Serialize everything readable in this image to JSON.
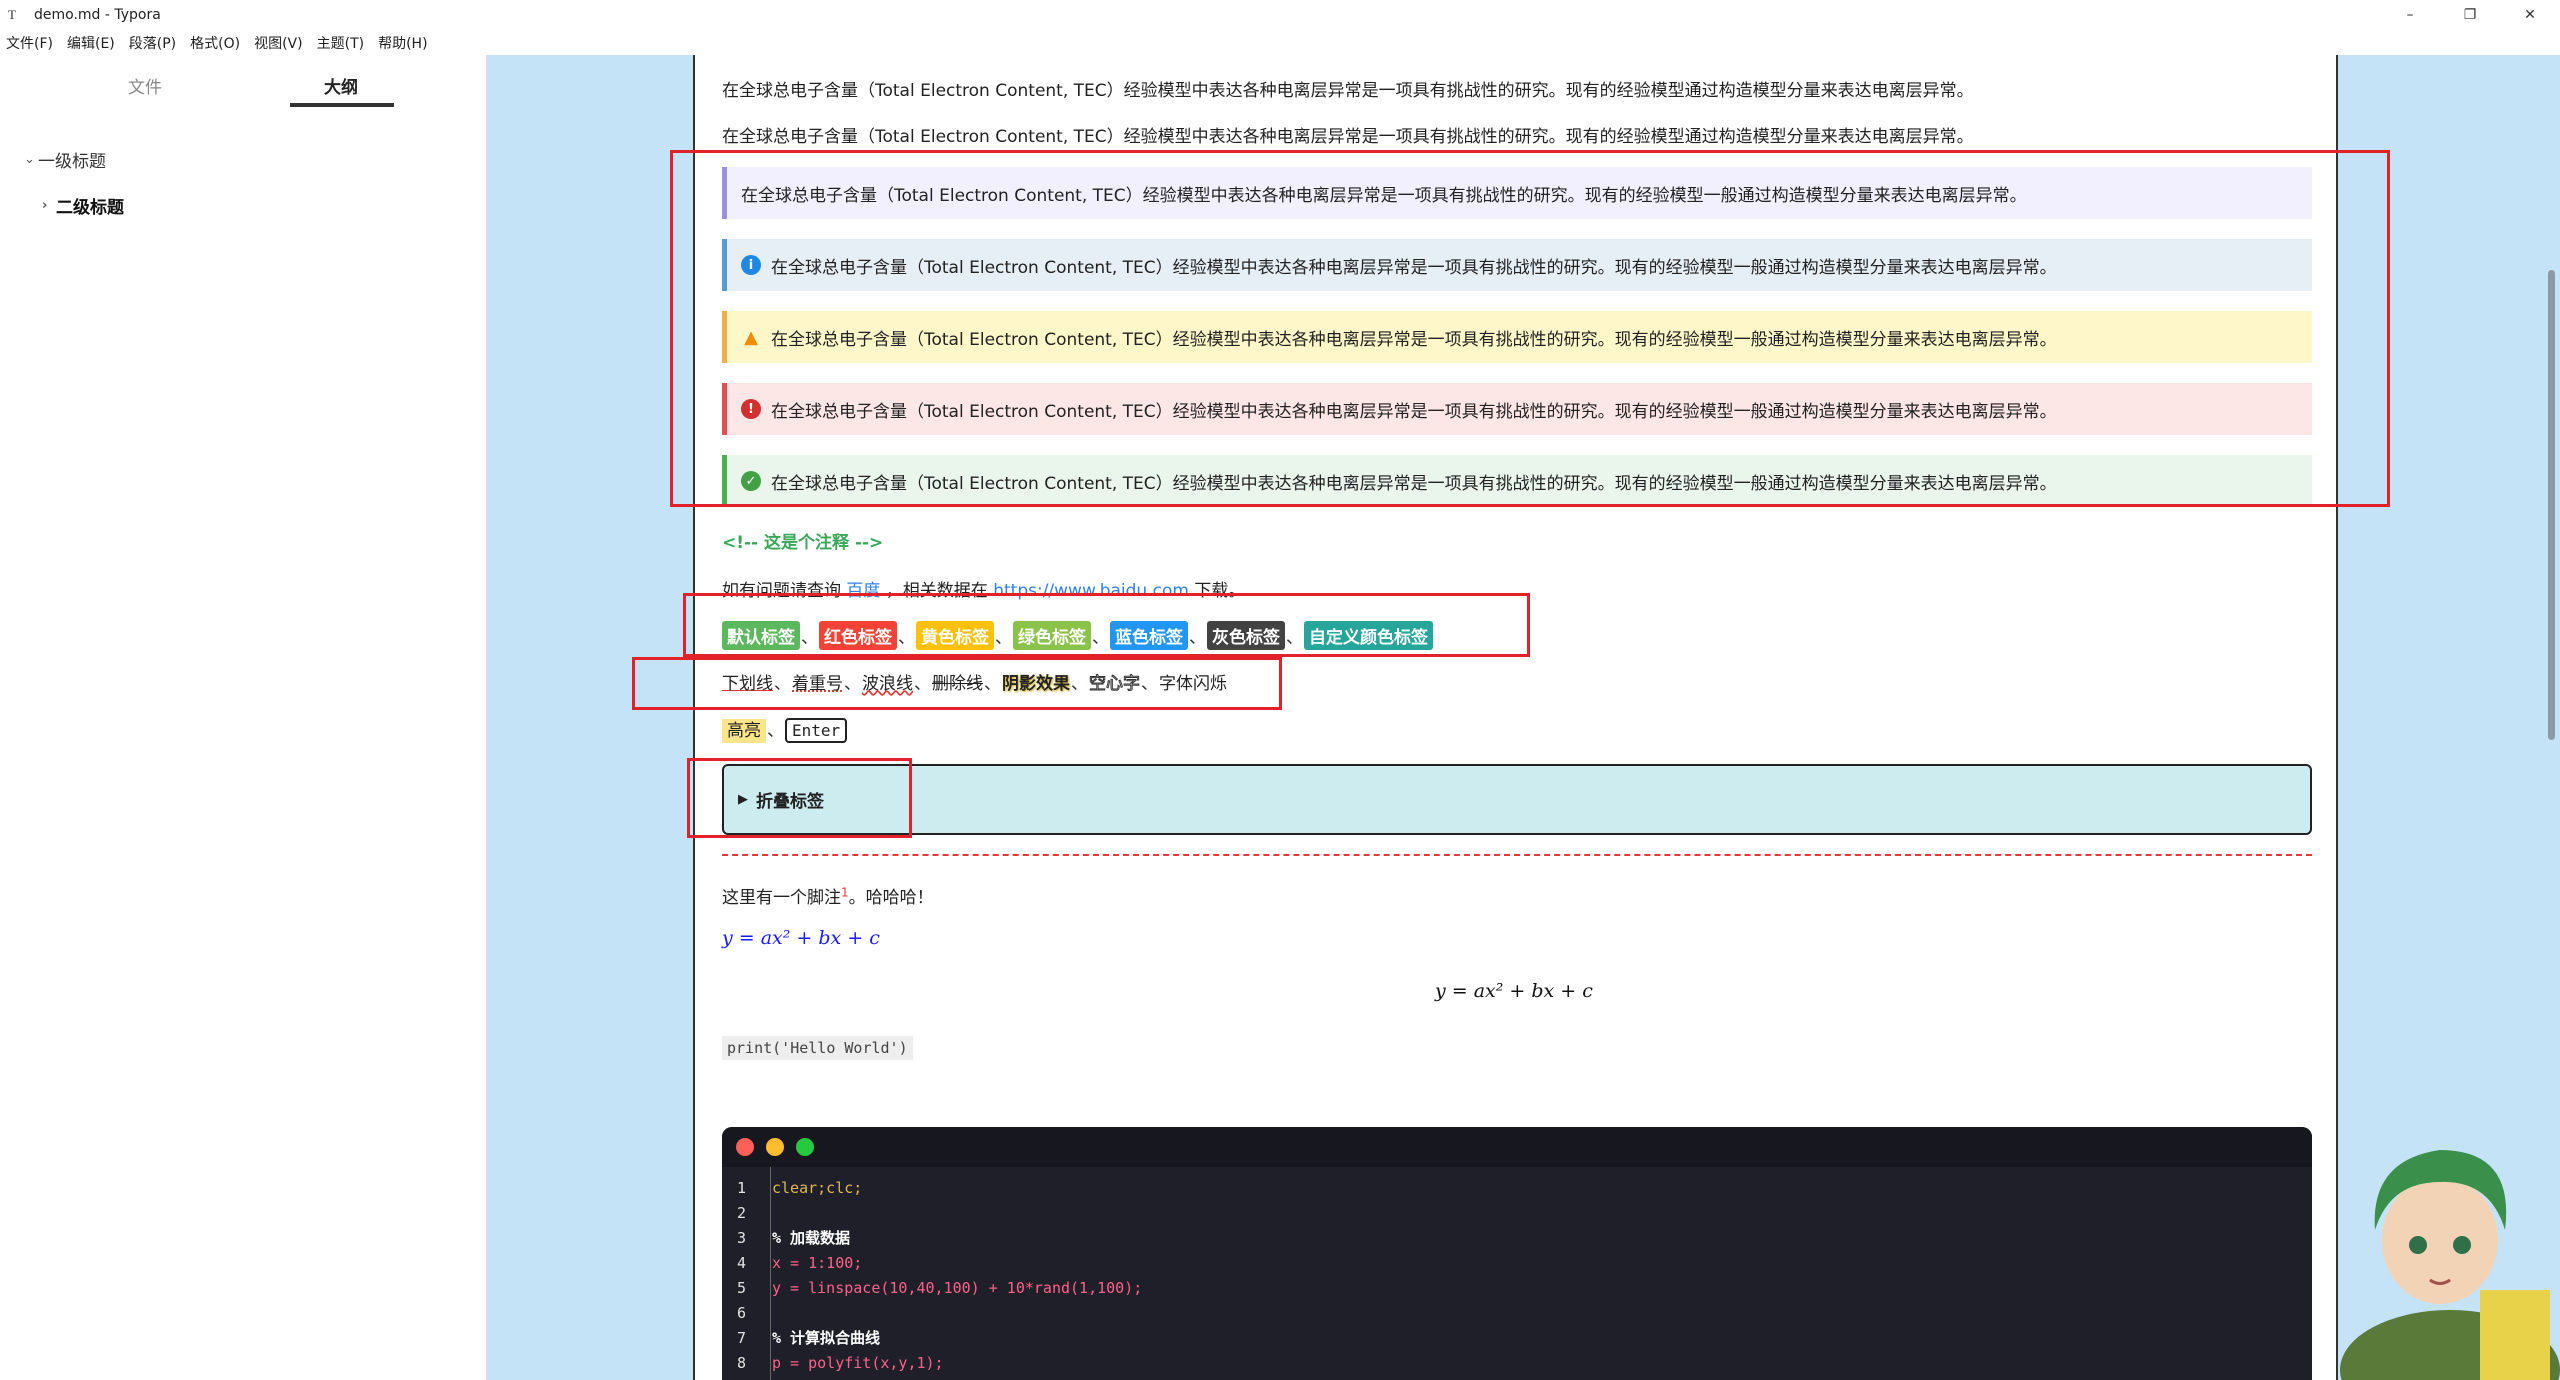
{
  "window": {
    "title": "demo.md - Typora",
    "app_icon": "T",
    "minimize": "–",
    "maximize": "❐",
    "close": "✕"
  },
  "menubar": [
    "文件(F)",
    "编辑(E)",
    "段落(P)",
    "格式(O)",
    "视图(V)",
    "主题(T)",
    "帮助(H)"
  ],
  "sidebar": {
    "tab_files": "文件",
    "tab_outline": "大纲",
    "outline": [
      {
        "label": "一级标题",
        "level": 1,
        "expanded": true
      },
      {
        "label": "二级标题",
        "level": 2,
        "expanded": false
      }
    ],
    "tool_back": "‹",
    "tool_source": "</>"
  },
  "document": {
    "para1": "在全球总电子含量（Total Electron Content, TEC）经验模型中表达各种电离层异常是一项具有挑战性的研究。现有的经验模型通过构造模型分量来表达电离层异常。",
    "para2": "在全球总电子含量（Total Electron Content, TEC）经验模型中表达各种电离层异常是一项具有挑战性的研究。现有的经验模型通过构造模型分量来表达电离层异常。",
    "callouts": [
      {
        "type": "note",
        "text": "在全球总电子含量（Total Electron Content, TEC）经验模型中表达各种电离层异常是一项具有挑战性的研究。现有的经验模型一般通过构造模型分量来表达电离层异常。",
        "border": "#9b8fe0",
        "bg": "#f2f0ff",
        "icon": ""
      },
      {
        "type": "info",
        "text": "在全球总电子含量（Total Electron Content, TEC）经验模型中表达各种电离层异常是一项具有挑战性的研究。现有的经验模型一般通过构造模型分量来表达电离层异常。",
        "border": "#5a9bd5",
        "bg": "#e6eef6",
        "icon": "i"
      },
      {
        "type": "warning",
        "text": "在全球总电子含量（Total Electron Content, TEC）经验模型中表达各种电离层异常是一项具有挑战性的研究。现有的经验模型一般通过构造模型分量来表达电离层异常。",
        "border": "#f0ad4e",
        "bg": "#fdf7c9",
        "icon": "!"
      },
      {
        "type": "danger",
        "text": "在全球总电子含量（Total Electron Content, TEC）经验模型中表达各种电离层异常是一项具有挑战性的研究。现有的经验模型一般通过构造模型分量来表达电离层异常。",
        "border": "#e05252",
        "bg": "#fde6e6",
        "icon": "!"
      },
      {
        "type": "success",
        "text": "在全球总电子含量（Total Electron Content, TEC）经验模型中表达各种电离层异常是一项具有挑战性的研究。现有的经验模型一般通过构造模型分量来表达电离层异常。",
        "border": "#4caf50",
        "bg": "#eaf6ec",
        "icon": "✓"
      }
    ],
    "comment": "<!-- 这是个注释 -->",
    "link_line": {
      "prefix": "如有问题请查询 ",
      "link1": "百度",
      "middle": " ，相关数据在 ",
      "link2": "https://www.baidu.com",
      "suffix": " 下载。"
    },
    "tags": [
      {
        "label": "默认标签",
        "color": "#5cb85c"
      },
      {
        "label": "红色标签",
        "color": "#f44336"
      },
      {
        "label": "黄色标签",
        "color": "#ffc107"
      },
      {
        "label": "绿色标签",
        "color": "#8bc34a"
      },
      {
        "label": "蓝色标签",
        "color": "#2196f3"
      },
      {
        "label": "灰色标签",
        "color": "#424242"
      },
      {
        "label": "自定义颜色标签",
        "color": "#26a69a"
      }
    ],
    "tag_sep": "、",
    "text_effects": {
      "underline": "下划线",
      "emphasis": "着重号",
      "wavy": "波浪线",
      "strike": "删除线",
      "shadow": "阴影效果",
      "hollow": "空心字",
      "blink": "字体闪烁"
    },
    "highlight": "高亮",
    "kbd": "Enter",
    "details_summary": "折叠标签",
    "footnote_line": {
      "text": "这里有一个脚注",
      "ref": "1",
      "after": "。哈哈哈！"
    },
    "inline_math": "y = ax² + bx + c",
    "block_math": "y = ax² + bx + c",
    "inline_code": "print('Hello World')",
    "code_lines": [
      {
        "n": "1",
        "text": "clear;clc;",
        "kind": "text"
      },
      {
        "n": "2",
        "text": "",
        "kind": "plain"
      },
      {
        "n": "3",
        "text": "% 加载数据",
        "kind": "comment"
      },
      {
        "n": "4",
        "text": "x = 1:100;",
        "kind": "var"
      },
      {
        "n": "5",
        "text": "y = linspace(10,40,100) + 10*rand(1,100);",
        "kind": "var"
      },
      {
        "n": "6",
        "text": "",
        "kind": "plain"
      },
      {
        "n": "7",
        "text": "% 计算拟合曲线",
        "kind": "comment"
      },
      {
        "n": "8",
        "text": "p = polyfit(x,y,1);",
        "kind": "var"
      }
    ],
    "mac_dots": [
      "#ff5f56",
      "#ffbd2e",
      "#27c93f"
    ]
  }
}
